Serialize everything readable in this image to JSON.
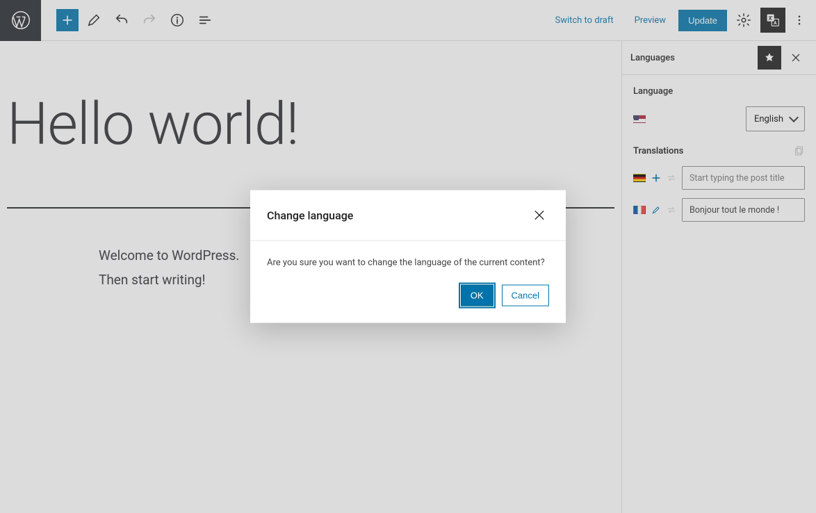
{
  "toolbar": {
    "switch_to_draft": "Switch to draft",
    "preview": "Preview",
    "update": "Update"
  },
  "editor": {
    "title": "Hello world!",
    "body_line1": "Welcome to WordPress.",
    "body_line2": "Then start writing!"
  },
  "sidebar": {
    "panel_title": "Languages",
    "language_label": "Language",
    "language_selected": "English",
    "translations_label": "Translations",
    "german_placeholder": "Start typing the post title",
    "french_value": "Bonjour tout le monde !"
  },
  "modal": {
    "title": "Change language",
    "message": "Are you sure you want to change the language of the current content?",
    "ok": "OK",
    "cancel": "Cancel"
  }
}
